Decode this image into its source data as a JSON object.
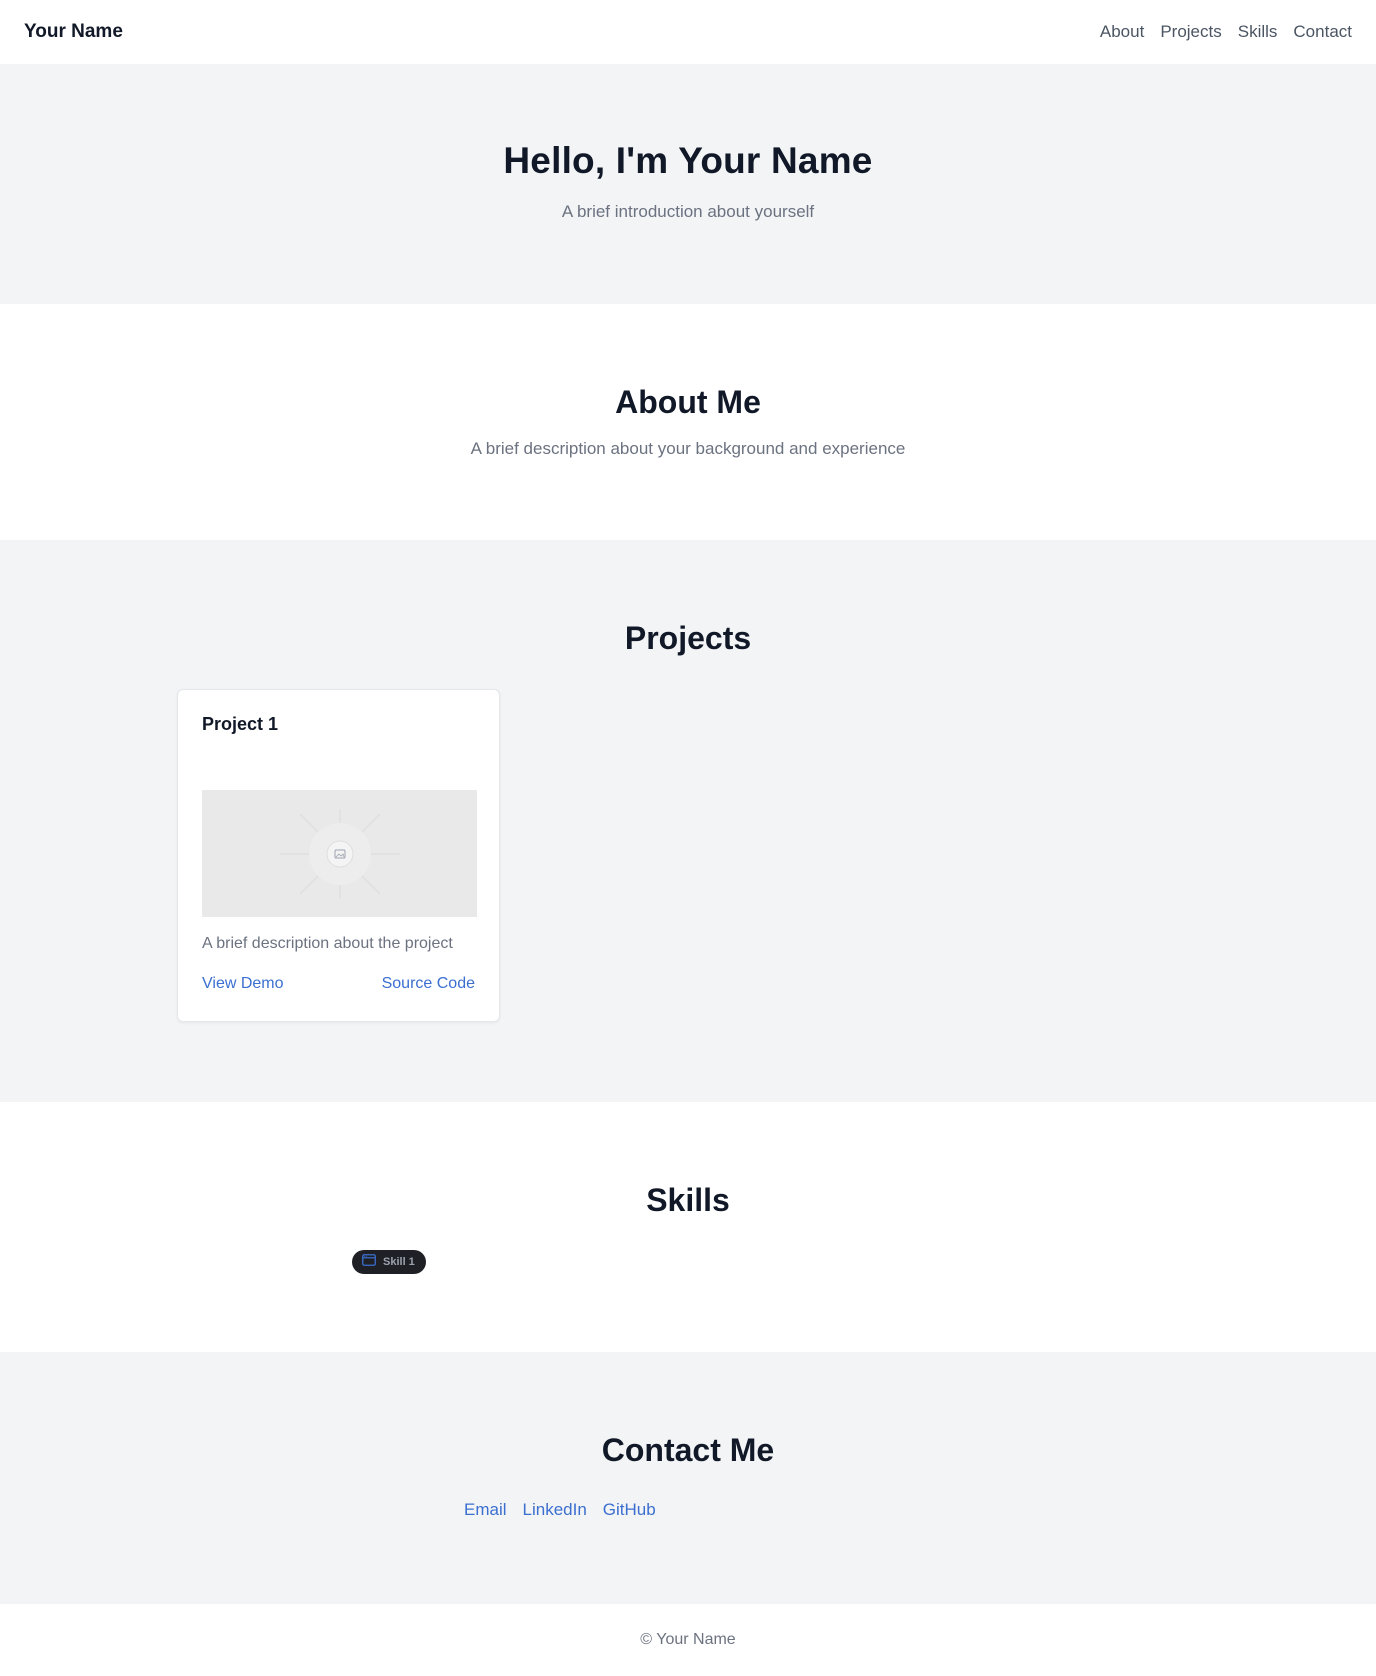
{
  "header": {
    "brand": "Your Name",
    "nav": [
      {
        "label": "About"
      },
      {
        "label": "Projects"
      },
      {
        "label": "Skills"
      },
      {
        "label": "Contact"
      }
    ]
  },
  "hero": {
    "title": "Hello, I'm Your Name",
    "subtitle": "A brief introduction about yourself"
  },
  "about": {
    "title": "About Me",
    "description": "A brief description about your background and experience"
  },
  "projects": {
    "title": "Projects",
    "items": [
      {
        "title": "Project 1",
        "image_icon": "image-placeholder-icon",
        "description": "A brief description about the project",
        "demo_label": "View Demo",
        "source_label": "Source Code"
      }
    ]
  },
  "skills": {
    "title": "Skills",
    "items": [
      {
        "label": "Skill 1",
        "icon": "browser-window-icon"
      }
    ]
  },
  "contact": {
    "title": "Contact Me",
    "links": [
      {
        "label": "Email"
      },
      {
        "label": "LinkedIn"
      },
      {
        "label": "GitHub"
      }
    ]
  },
  "footer": {
    "text": "© Your Name"
  },
  "colors": {
    "accent": "#3b6fd0",
    "heading": "#111827",
    "muted": "#6b7280",
    "section_gray": "#f3f4f6",
    "pill_bg": "#1f2025",
    "skill_icon": "#3b6fd0"
  }
}
